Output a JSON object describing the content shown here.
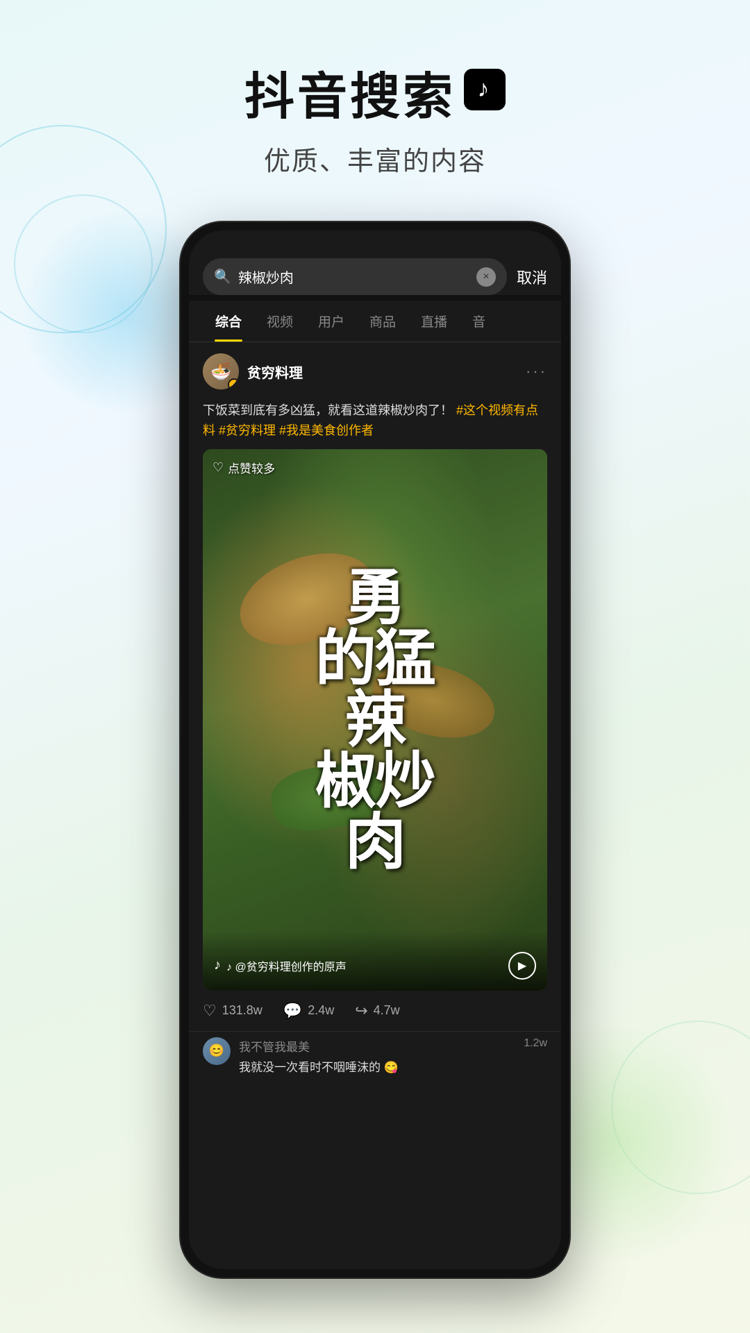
{
  "page": {
    "background": "light-gradient"
  },
  "header": {
    "title": "抖音搜索",
    "subtitle": "优质、丰富的内容",
    "logo_icon": "tiktok-note-icon"
  },
  "phone": {
    "search_bar": {
      "query": "辣椒炒肉",
      "clear_icon": "×",
      "cancel_label": "取消"
    },
    "tabs": [
      {
        "label": "综合",
        "active": true
      },
      {
        "label": "视频",
        "active": false
      },
      {
        "label": "用户",
        "active": false
      },
      {
        "label": "商品",
        "active": false
      },
      {
        "label": "直播",
        "active": false
      },
      {
        "label": "音",
        "active": false
      }
    ],
    "post": {
      "author": {
        "name": "贫穷料理",
        "verified": true,
        "avatar_emoji": "🍜"
      },
      "description": "下饭菜到底有多凶猛，就看这道辣椒炒肉了！",
      "hashtags": [
        "#这个视频有点料",
        "#贫穷料理",
        "#我是美食创作者"
      ],
      "likes_badge": "点赞较多",
      "video_title": "勇的猛辣椒炒肉",
      "audio_info": "♪ @贫穷料理创作的原声",
      "stats": {
        "likes": "131.8w",
        "comments": "2.4w",
        "shares": "4.7w"
      },
      "comments": [
        {
          "name": "我不管我最美",
          "text": "我就没一次看时不咽唾沫的 😋",
          "likes": "1.2w",
          "avatar_emoji": "😊"
        }
      ]
    }
  }
}
